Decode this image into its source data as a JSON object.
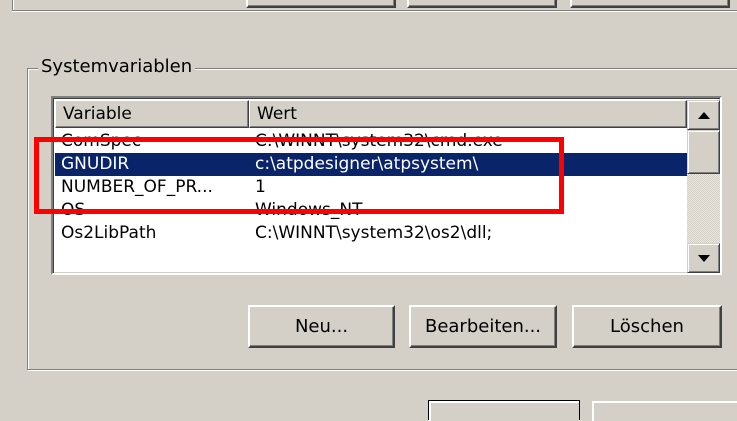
{
  "group": {
    "title": "Systemvariablen"
  },
  "listview": {
    "columns": [
      "Variable",
      "Wert"
    ],
    "rows": [
      {
        "variable": "ComSpec",
        "value": "C:\\WINNT\\system32\\cmd.exe"
      },
      {
        "variable": "GNUDIR",
        "value": "c:\\atpdesigner\\atpsystem\\"
      },
      {
        "variable": "NUMBER_OF_PR...",
        "value": "1"
      },
      {
        "variable": "OS",
        "value": "Windows_NT"
      },
      {
        "variable": "Os2LibPath",
        "value": "C:\\WINNT\\system32\\os2\\dll;"
      }
    ],
    "selected_row": 1
  },
  "buttons": {
    "new": "Neu...",
    "edit": "Bearbeiten...",
    "delete": "Löschen"
  },
  "colors": {
    "face": "#d4d0c8",
    "selection": "#0a246a",
    "annotation": "#ff0000"
  },
  "icons": [
    "scroll-up-arrow-icon",
    "scroll-down-arrow-icon"
  ]
}
